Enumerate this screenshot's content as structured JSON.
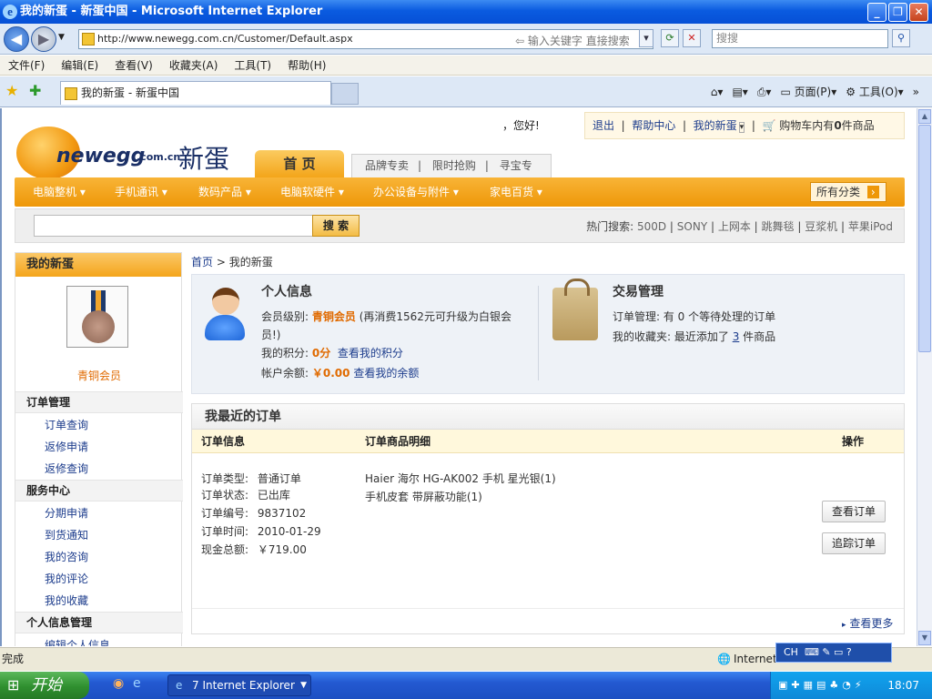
{
  "browser": {
    "title": "我的新蛋 - 新蛋中国 - Microsoft Internet Explorer",
    "url": "http://www.newegg.com.cn/Customer/Default.aspx",
    "url_hint": "输入关键字 直接搜索",
    "search_placeholder": "搜搜",
    "menu": [
      "文件(F)",
      "编辑(E)",
      "查看(V)",
      "收藏夹(A)",
      "工具(T)",
      "帮助(H)"
    ],
    "tab_label": "我的新蛋 - 新蛋中国",
    "cmd_page": "页面(P)",
    "cmd_tools": "工具(O)",
    "status": "完成",
    "zone": "Internet"
  },
  "taskbar": {
    "start": "开始",
    "task": "7 Internet Explorer",
    "clock": "18:07",
    "lang": "CH"
  },
  "site": {
    "greeting": "，您好!",
    "top_links": [
      "退出",
      "帮助中心",
      "我的新蛋"
    ],
    "cart_prefix": "购物车内有",
    "cart_count": "0",
    "cart_suffix": "件商品",
    "logo_text": "newegg",
    "logo_domain": ".com.cn",
    "logo_cn": "新蛋",
    "home_tab": "首 页",
    "sub_tabs": [
      "品牌专卖",
      "限时抢购",
      "寻宝专区"
    ],
    "categories": [
      "电脑整机",
      "手机通讯",
      "数码产品",
      "电脑软硬件",
      "办公设备与附件",
      "家电百货"
    ],
    "all_categories": "所有分类",
    "search_button": "搜 索",
    "hot_label": "热门搜索:",
    "hot_terms": [
      "500D",
      "SONY",
      "上网本",
      "跳舞毯",
      "豆浆机",
      "苹果iPod"
    ]
  },
  "sidebar": {
    "title": "我的新蛋",
    "level": "青铜会员",
    "sections": [
      {
        "title": "订单管理",
        "items": [
          "订单查询",
          "返修申请",
          "返修查询"
        ]
      },
      {
        "title": "服务中心",
        "items": [
          "分期申请",
          "到货通知",
          "我的咨询",
          "我的评论",
          "我的收藏"
        ]
      },
      {
        "title": "个人信息管理",
        "items": [
          "编辑个人信息"
        ]
      }
    ]
  },
  "breadcrumb": {
    "home": "首页",
    "sep": ">",
    "current": "我的新蛋"
  },
  "personal": {
    "title": "个人信息",
    "level_label": "会员级别:",
    "level_value": "青铜会员",
    "level_note_1": "(再消费1562元可升级为白银会",
    "level_note_2": "员!)",
    "points_label": "我的积分:",
    "points_value": "0分",
    "points_link": "查看我的积分",
    "balance_label": "帐户余额:",
    "balance_value": "￥0.00",
    "balance_link": "查看我的余额"
  },
  "trade": {
    "title": "交易管理",
    "orders_text": "订单管理: 有 0 个等待处理的订单",
    "fav_prefix": "我的收藏夹: 最近添加了",
    "fav_count": "3",
    "fav_suffix": "件商品"
  },
  "orders": {
    "title": "我最近的订单",
    "headers": [
      "订单信息",
      "订单商品明细",
      "操作"
    ],
    "info": [
      {
        "label": "订单类型:",
        "value": "普通订单"
      },
      {
        "label": "订单状态:",
        "value": "已出库"
      },
      {
        "label": "订单编号:",
        "value": "9837102"
      },
      {
        "label": "订单时间:",
        "value": "2010-01-29"
      },
      {
        "label": "现金总额:",
        "value": "￥719.00"
      }
    ],
    "items": [
      "Haier 海尔 HG-AK002 手机 星光银(1)",
      "手机皮套 带屏蔽功能(1)"
    ],
    "btn_view": "查看订单",
    "btn_track": "追踪订单",
    "more": "查看更多"
  }
}
